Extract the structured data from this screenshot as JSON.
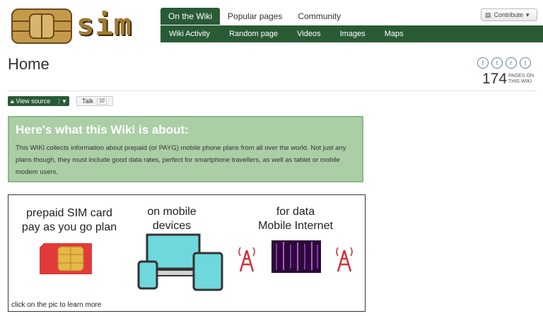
{
  "header": {
    "logo_text": "sim",
    "tabs": [
      {
        "label": "On the Wiki",
        "active": true
      },
      {
        "label": "Popular pages"
      },
      {
        "label": "Community"
      }
    ],
    "subnav": [
      "Wiki Activity",
      "Random page",
      "Videos",
      "Images",
      "Maps"
    ],
    "contribute_label": "Contribute"
  },
  "page": {
    "title": "Home",
    "pages_count": "174",
    "pages_label_1": "PAGES ON",
    "pages_label_2": "THIS WIKI",
    "social": [
      "f",
      "t",
      "r",
      "t"
    ]
  },
  "actions": {
    "view_source": "View source",
    "talk": "Talk",
    "talk_count": "10"
  },
  "about": {
    "heading": "Here's what this Wiki is about:",
    "body": "This WIKI collects information about prepaid (or PAYG) mobile phone plans from all over the world. Not just any plans though, they must include good data rates, perfect for smartphone travellers, as well as tablet or mobile modem users."
  },
  "banner": {
    "col1_line1": "prepaid SIM card",
    "col1_line2": "pay as you go plan",
    "col2_line1": "on mobile",
    "col2_line2": "devices",
    "col3_line1": "for data",
    "col3_line2": "Mobile Internet",
    "footer": "click on the pic to learn more"
  },
  "colors": {
    "nav_green": "#295b35",
    "about_bg": "#abcea6",
    "sim_red": "#e23a3a",
    "chip_gold": "#e6b74a",
    "device_cyan": "#6fd8dc",
    "tower_red": "#d2303a",
    "data_purple": "#6a1f8a"
  }
}
